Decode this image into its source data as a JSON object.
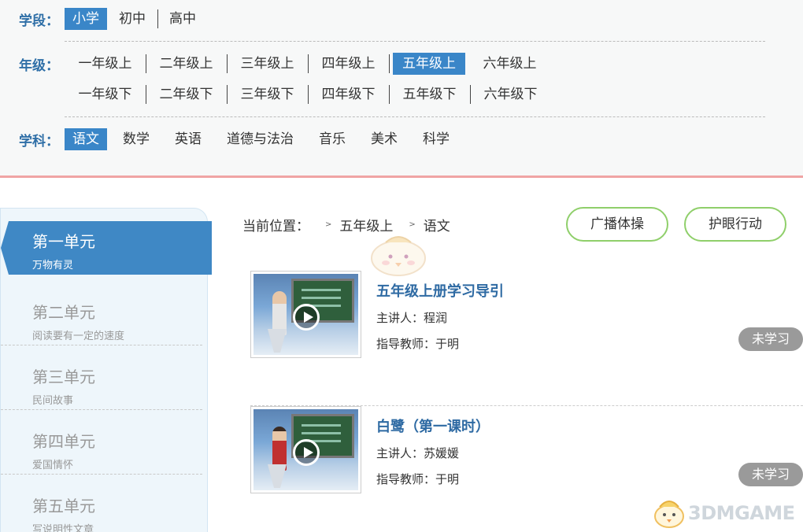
{
  "filters": {
    "stage": {
      "label": "学段：",
      "options": [
        "小学",
        "初中",
        "高中"
      ]
    },
    "grade": {
      "label": "年级：",
      "upper": [
        "一年级上",
        "二年级上",
        "三年级上",
        "四年级上",
        "五年级上",
        "六年级上"
      ],
      "lower": [
        "一年级下",
        "二年级下",
        "三年级下",
        "四年级下",
        "五年级下",
        "六年级下"
      ]
    },
    "subject": {
      "label": "学科：",
      "options": [
        "语文",
        "数学",
        "英语",
        "道德与法治",
        "音乐",
        "美术",
        "科学"
      ]
    }
  },
  "sidebar": {
    "units": [
      {
        "name": "第一单元",
        "sub": "万物有灵"
      },
      {
        "name": "第二单元",
        "sub": "阅读要有一定的速度"
      },
      {
        "name": "第三单元",
        "sub": "民间故事"
      },
      {
        "name": "第四单元",
        "sub": "爱国情怀"
      },
      {
        "name": "第五单元",
        "sub": "写说明性文章"
      }
    ]
  },
  "breadcrumb": {
    "prefix": "当前位置：",
    "items": [
      "五年级上",
      "语文"
    ]
  },
  "actions": {
    "exercise": "广播体操",
    "eye_care": "护眼行动"
  },
  "lessons": [
    {
      "title": "五年级上册学习导引",
      "lecturer": "主讲人：程润",
      "advisor": "指导教师：于明",
      "status": "未学习"
    },
    {
      "title": "白鹭（第一课时）",
      "lecturer": "主讲人：苏媛媛",
      "advisor": "指导教师：于明",
      "status": "未学习"
    }
  ],
  "watermark": "3DMGAME",
  "colors": {
    "accent": "#3a86c8",
    "title": "#2e6aa3",
    "pill_border": "#8fcf6a",
    "divider": "#f0a4a4"
  }
}
